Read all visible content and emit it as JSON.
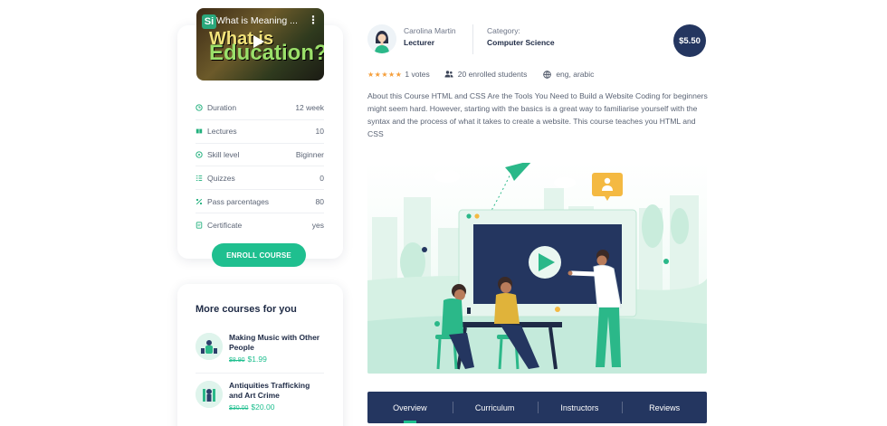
{
  "video": {
    "title": "What is Meaning ...",
    "logo": "Si",
    "big_line_1": "What is",
    "big_line_2": "Education?"
  },
  "course_info": [
    {
      "icon": "clock-icon",
      "label": "Duration",
      "value": "12 week"
    },
    {
      "icon": "book-icon",
      "label": "Lectures",
      "value": "10"
    },
    {
      "icon": "gauge-icon",
      "label": "Skill level",
      "value": "Biginner"
    },
    {
      "icon": "list-icon",
      "label": "Quizzes",
      "value": "0"
    },
    {
      "icon": "percent-icon",
      "label": "Pass parcentages",
      "value": "80"
    },
    {
      "icon": "certificate-icon",
      "label": "Certificate",
      "value": "yes"
    }
  ],
  "enroll_label": "ENROLL COURSE",
  "more_courses": {
    "title": "More courses for you",
    "items": [
      {
        "title": "Making Music with Other People",
        "old_price": "$8.90",
        "price": "$1.99"
      },
      {
        "title": "Antiquities Trafficking and Art Crime",
        "old_price": "$30.00",
        "price": "$20.00"
      }
    ]
  },
  "instructor": {
    "name": "Carolina Martin",
    "role": "Lecturer"
  },
  "category": {
    "label": "Category:",
    "value": "Computer Science"
  },
  "price": "$5.50",
  "rating": {
    "stars": "★★★★★",
    "votes": "1 votes"
  },
  "enrolled": "20 enrolled students",
  "languages": "eng, arabic",
  "description": "About this Course HTML and CSS Are the Tools You Need to Build a Website Coding for beginners might seem hard. However, starting with the basics is a great way to familiarise yourself with the syntax and the process of what it takes to create a website. This course teaches you HTML and CSS",
  "tabs": [
    "Overview",
    "Curriculum",
    "Instructors",
    "Reviews"
  ],
  "colors": {
    "accent": "#1fbf8f",
    "navy": "#243660",
    "star": "#f59e3a"
  }
}
